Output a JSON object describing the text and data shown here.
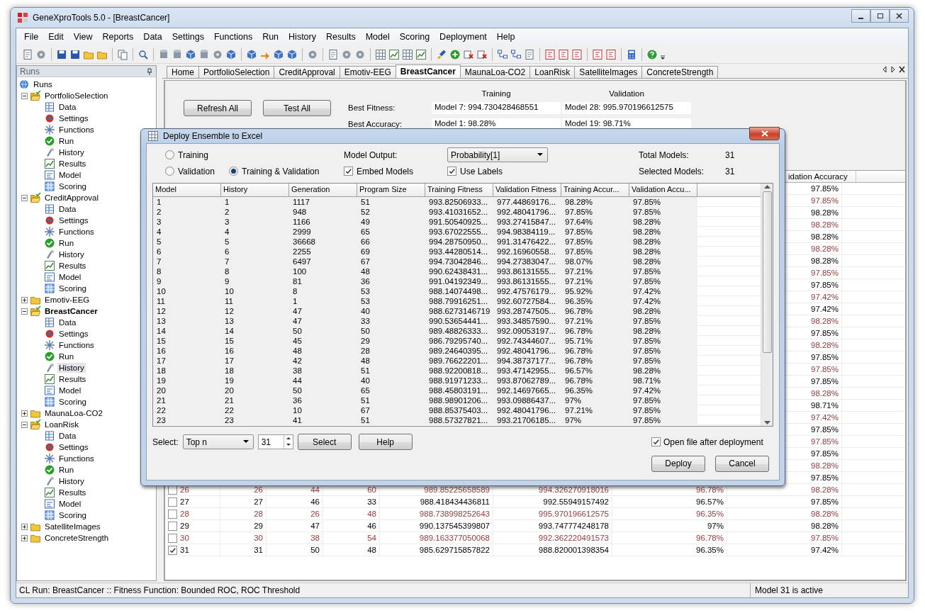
{
  "window": {
    "title": "GeneXproTools 5.0 - [BreastCancer]"
  },
  "menu": [
    "File",
    "Edit",
    "View",
    "Reports",
    "Data",
    "Settings",
    "Functions",
    "Run",
    "History",
    "Results",
    "Model",
    "Scoring",
    "Deployment",
    "Help"
  ],
  "runs_panel": {
    "title": "Runs",
    "tree": {
      "label": "Runs",
      "selected": false,
      "children": [
        {
          "label": "PortfolioSelection",
          "selected": false,
          "active": false,
          "expanded": true,
          "children": [
            {
              "label": "Data",
              "selected": false
            },
            {
              "label": "Settings",
              "selected": false
            },
            {
              "label": "Functions",
              "selected": false
            },
            {
              "label": "Run",
              "selected": false
            },
            {
              "label": "History",
              "selected": false
            },
            {
              "label": "Results",
              "selected": false
            },
            {
              "label": "Model",
              "selected": false
            },
            {
              "label": "Scoring",
              "selected": false
            }
          ]
        },
        {
          "label": "CreditApproval",
          "selected": false,
          "active": false,
          "expanded": true,
          "children": [
            {
              "label": "Data",
              "selected": false
            },
            {
              "label": "Settings",
              "selected": false
            },
            {
              "label": "Functions",
              "selected": false
            },
            {
              "label": "Run",
              "selected": false
            },
            {
              "label": "History",
              "selected": false
            },
            {
              "label": "Results",
              "selected": false
            },
            {
              "label": "Model",
              "selected": false
            },
            {
              "label": "Scoring",
              "selected": false
            }
          ]
        },
        {
          "label": "Emotiv-EEG",
          "selected": false,
          "active": false,
          "expanded": false
        },
        {
          "label": "BreastCancer",
          "selected": false,
          "active": true,
          "expanded": true,
          "children": [
            {
              "label": "Data",
              "selected": false
            },
            {
              "label": "Settings",
              "selected": false
            },
            {
              "label": "Functions",
              "selected": false
            },
            {
              "label": "Run",
              "selected": false
            },
            {
              "label": "History",
              "selected": true
            },
            {
              "label": "Results",
              "selected": false
            },
            {
              "label": "Model",
              "selected": false
            },
            {
              "label": "Scoring",
              "selected": false
            }
          ]
        },
        {
          "label": "MaunaLoa-CO2",
          "selected": false,
          "active": false,
          "expanded": false
        },
        {
          "label": "LoanRisk",
          "selected": false,
          "active": false,
          "expanded": true,
          "children": [
            {
              "label": "Data",
              "selected": false
            },
            {
              "label": "Settings",
              "selected": false
            },
            {
              "label": "Functions",
              "selected": false
            },
            {
              "label": "Run",
              "selected": false
            },
            {
              "label": "History",
              "selected": false
            },
            {
              "label": "Results",
              "selected": false
            },
            {
              "label": "Model",
              "selected": false
            },
            {
              "label": "Scoring",
              "selected": false
            }
          ]
        },
        {
          "label": "SatelliteImages",
          "selected": false,
          "active": false,
          "expanded": false
        },
        {
          "label": "ConcreteStrength",
          "selected": false,
          "active": false,
          "expanded": false
        }
      ]
    }
  },
  "tabs": [
    {
      "label": "Home",
      "selected": false
    },
    {
      "label": "PortfolioSelection",
      "selected": false
    },
    {
      "label": "CreditApproval",
      "selected": false
    },
    {
      "label": "Emotiv-EEG",
      "selected": false
    },
    {
      "label": "BreastCancer",
      "selected": true
    },
    {
      "label": "MaunaLoa-CO2",
      "selected": false
    },
    {
      "label": "LoanRisk",
      "selected": false
    },
    {
      "label": "SatelliteImages",
      "selected": false
    },
    {
      "label": "ConcreteStrength",
      "selected": false
    }
  ],
  "summary": {
    "buttons": [
      "Refresh All",
      "Test All"
    ],
    "headers": [
      "Training",
      "Validation"
    ],
    "rows": [
      {
        "label": "Best Fitness:",
        "training": "Model 7: 994.730428468551",
        "validation": "Model 28: 995.970196612575"
      },
      {
        "label": "Best Accuracy:",
        "training": "Model 1: 98.28%",
        "validation": "Model 19: 98.71%"
      }
    ]
  },
  "models_table": {
    "visible_header": "idation Accuracy",
    "rows": [
      {
        "validation_accuracy": "97.85%"
      },
      {
        "validation_accuracy": "97.85%"
      },
      {
        "validation_accuracy": "98.28%"
      },
      {
        "validation_accuracy": "98.28%"
      },
      {
        "validation_accuracy": "98.28%"
      },
      {
        "validation_accuracy": "98.28%"
      },
      {
        "validation_accuracy": "98.28%"
      },
      {
        "validation_accuracy": "97.85%"
      },
      {
        "validation_accuracy": "97.85%"
      },
      {
        "validation_accuracy": "97.42%"
      },
      {
        "validation_accuracy": "97.42%"
      },
      {
        "validation_accuracy": "98.28%"
      },
      {
        "validation_accuracy": "97.85%"
      },
      {
        "validation_accuracy": "98.28%"
      },
      {
        "validation_accuracy": "97.85%"
      },
      {
        "validation_accuracy": "97.85%"
      },
      {
        "validation_accuracy": "97.85%"
      },
      {
        "validation_accuracy": "98.28%"
      },
      {
        "validation_accuracy": "98.71%"
      },
      {
        "validation_accuracy": "97.42%"
      },
      {
        "validation_accuracy": "97.85%"
      },
      {
        "validation_accuracy": "97.85%"
      },
      {
        "validation_accuracy": "97.85%"
      },
      {
        "validation_accuracy": "98.28%"
      },
      {
        "validation_accuracy": "97.85%"
      },
      {
        "checked": false,
        "model": "26",
        "history": "26",
        "generation": "44",
        "program_size": "60",
        "training_fitness": "989.85225658589",
        "validation_fitness": "994.326270918016",
        "training_accuracy": "96.78%",
        "validation_accuracy": "98.28%"
      },
      {
        "checked": false,
        "model": "27",
        "history": "27",
        "generation": "46",
        "program_size": "33",
        "training_fitness": "988.418434436811",
        "validation_fitness": "992.55949157492",
        "training_accuracy": "96.57%",
        "validation_accuracy": "97.85%"
      },
      {
        "checked": false,
        "model": "28",
        "history": "28",
        "generation": "26",
        "program_size": "48",
        "training_fitness": "988.738998252643",
        "validation_fitness": "995.970196612575",
        "training_accuracy": "96.35%",
        "validation_accuracy": "98.28%"
      },
      {
        "checked": false,
        "model": "29",
        "history": "29",
        "generation": "47",
        "program_size": "46",
        "training_fitness": "990.137545399807",
        "validation_fitness": "993.747774248178",
        "training_accuracy": "97%",
        "validation_accuracy": "98.28%"
      },
      {
        "checked": false,
        "model": "30",
        "history": "30",
        "generation": "38",
        "program_size": "54",
        "training_fitness": "989.163377050068",
        "validation_fitness": "992.362220491573",
        "training_accuracy": "96.78%",
        "validation_accuracy": "97.85%"
      },
      {
        "checked": true,
        "model": "31",
        "history": "31",
        "generation": "50",
        "program_size": "48",
        "training_fitness": "985.629715857822",
        "validation_fitness": "988.820001398354",
        "training_accuracy": "96.35%",
        "validation_accuracy": "97.42%"
      }
    ]
  },
  "dialog": {
    "title": "Deploy Ensemble to Excel",
    "data_sets": [
      {
        "label": "Training",
        "selected": false
      },
      {
        "label": "Validation",
        "selected": false
      },
      {
        "label": "Training & Validation",
        "selected": true
      }
    ],
    "model_output": {
      "label": "Model Output:",
      "value": "Probability[1]"
    },
    "options": [
      {
        "label": "Embed Models",
        "checked": true
      },
      {
        "label": "Use Labels",
        "checked": true
      }
    ],
    "totals": [
      {
        "label": "Total Models:",
        "value": "31"
      },
      {
        "label": "Selected Models:",
        "value": "31"
      }
    ],
    "table": {
      "columns": [
        "Model",
        "History",
        "Generation",
        "Program Size",
        "Training Fitness",
        "Validation Fitness",
        "Training Accur...",
        "Validation Accu..."
      ],
      "rows": [
        [
          "1",
          "1",
          "1117",
          "51",
          "993.82506933...",
          "977.44869176...",
          "98.28%",
          "97.85%"
        ],
        [
          "2",
          "2",
          "948",
          "52",
          "993.41031652...",
          "992.48041796...",
          "97.85%",
          "97.85%"
        ],
        [
          "3",
          "3",
          "1166",
          "49",
          "991.50540925...",
          "993.27415847...",
          "97.64%",
          "98.28%"
        ],
        [
          "4",
          "4",
          "2999",
          "65",
          "993.67022555...",
          "994.98384119...",
          "97.85%",
          "98.28%"
        ],
        [
          "5",
          "5",
          "36668",
          "66",
          "994.28750950...",
          "991.31476422...",
          "97.85%",
          "98.28%"
        ],
        [
          "6",
          "6",
          "2255",
          "69",
          "993.44280514...",
          "992.16960558...",
          "97.85%",
          "98.28%"
        ],
        [
          "7",
          "7",
          "6497",
          "67",
          "994.73042846...",
          "994.27383047...",
          "98.07%",
          "98.28%"
        ],
        [
          "8",
          "8",
          "100",
          "48",
          "990.62438431...",
          "993.86131555...",
          "97.21%",
          "97.85%"
        ],
        [
          "9",
          "9",
          "81",
          "36",
          "991.04192349...",
          "993.86131555...",
          "97.21%",
          "97.85%"
        ],
        [
          "10",
          "10",
          "8",
          "53",
          "988.14074498...",
          "992.47576179...",
          "95.92%",
          "97.42%"
        ],
        [
          "11",
          "11",
          "1",
          "53",
          "988.79916251...",
          "992.60727584...",
          "96.35%",
          "97.42%"
        ],
        [
          "12",
          "12",
          "47",
          "40",
          "988.6273146719",
          "993.28747505...",
          "96.78%",
          "98.28%"
        ],
        [
          "13",
          "13",
          "47",
          "33",
          "990.53654441...",
          "993.34857590...",
          "97.21%",
          "97.85%"
        ],
        [
          "14",
          "14",
          "50",
          "50",
          "989.48826333...",
          "992.09053197...",
          "96.78%",
          "98.28%"
        ],
        [
          "15",
          "15",
          "45",
          "29",
          "986.79295740...",
          "992.74344607...",
          "95.71%",
          "97.85%"
        ],
        [
          "16",
          "16",
          "48",
          "28",
          "989.24640395...",
          "992.48041796...",
          "96.78%",
          "97.85%"
        ],
        [
          "17",
          "17",
          "42",
          "48",
          "989.76622201...",
          "994.38737177...",
          "96.78%",
          "97.85%"
        ],
        [
          "18",
          "18",
          "38",
          "51",
          "988.92200818...",
          "993.47142955...",
          "96.57%",
          "98.28%"
        ],
        [
          "19",
          "19",
          "44",
          "40",
          "988.91971233...",
          "993.87062789...",
          "96.78%",
          "98.71%"
        ],
        [
          "20",
          "20",
          "50",
          "65",
          "988.45803191...",
          "992.14697665...",
          "96.35%",
          "97.42%"
        ],
        [
          "21",
          "21",
          "36",
          "51",
          "988.98901206...",
          "993.09886437...",
          "97%",
          "97.85%"
        ],
        [
          "22",
          "22",
          "10",
          "67",
          "988.85375403...",
          "992.48041796...",
          "97.21%",
          "97.85%"
        ],
        [
          "23",
          "23",
          "41",
          "51",
          "988.57327821...",
          "993.21706185...",
          "97%",
          "97.85%"
        ]
      ]
    },
    "select": {
      "label": "Select:",
      "mode": "Top n",
      "count": "31",
      "buttons": [
        "Select",
        "Help"
      ]
    },
    "open_after": {
      "label": "Open file after deployment",
      "checked": true
    },
    "buttons": [
      "Deploy",
      "Cancel"
    ]
  },
  "status_bar": {
    "left": "CL Run: BreastCancer :: Fitness Function: Bounded ROC, ROC Threshold",
    "right": "Model 31 is active"
  }
}
